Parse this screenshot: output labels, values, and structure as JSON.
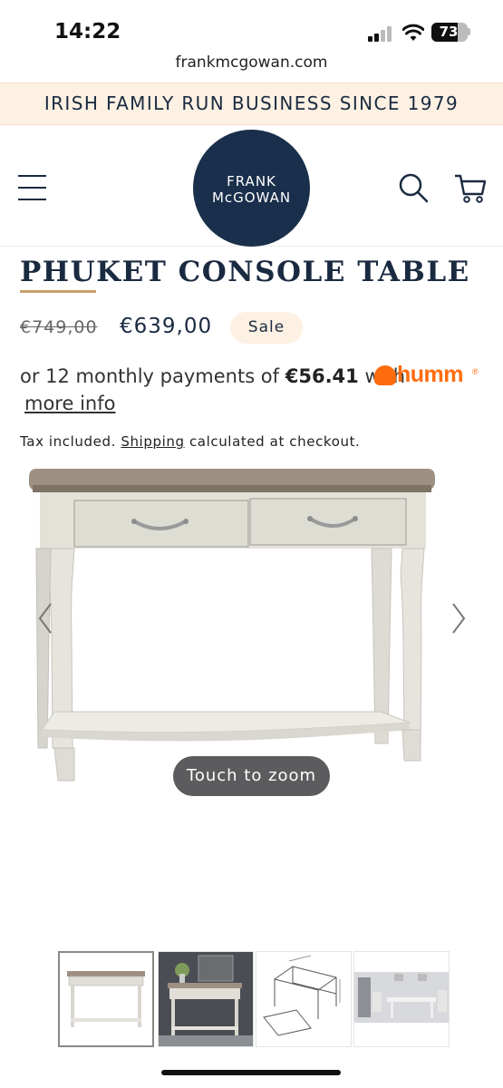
{
  "status_bar": {
    "time": "14:22",
    "battery": "73",
    "battery_level": 0.73
  },
  "browser": {
    "url": "frankmcgowan.com"
  },
  "banner": {
    "text": "IRISH FAMILY RUN BUSINESS SINCE 1979"
  },
  "header": {
    "logo_line1": "FRANK",
    "logo_line2": "McGOWAN",
    "icons": [
      "menu-icon",
      "search-icon",
      "cart-icon"
    ]
  },
  "product": {
    "title": "PHUKET CONSOLE TABLE",
    "old_price": "€749,00",
    "price": "€639,00",
    "sale_badge": "Sale",
    "installment_prefix": "or 12 monthly payments of ",
    "installment_amount": "€56.41",
    "installment_suffix": " with",
    "humm_brand": "humm",
    "more_info": "more info",
    "tax_prefix": "Tax included. ",
    "tax_shipping_link": "Shipping",
    "tax_suffix": " calculated at checkout."
  },
  "gallery": {
    "zoom_hint": "Touch to zoom",
    "thumbnail_count": 4
  },
  "colors": {
    "navy": "#1a2f4b",
    "banner_bg": "#fdf1e3",
    "accent_gold": "#c9a06b",
    "humm_orange": "#ff6c0e"
  }
}
